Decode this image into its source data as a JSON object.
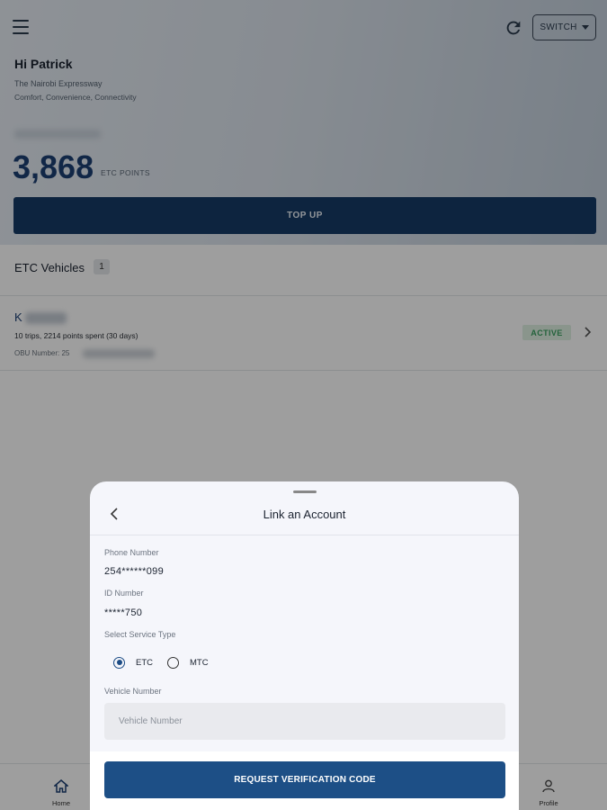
{
  "header": {
    "switch_label": "SWITCH",
    "greeting": "Hi Patrick",
    "tagline": "The Nairobi Expressway",
    "subtagline": "Comfort, Convenience, Connectivity",
    "points": "3,868",
    "points_unit": "ETC POINTS",
    "topup_label": "TOP UP"
  },
  "vehicles": {
    "section_title": "ETC Vehicles",
    "count": "1",
    "items": [
      {
        "name_prefix": "K",
        "stats": "10 trips, 2214 points spent (30 days)",
        "obu_prefix": "OBU Number: 25",
        "status": "ACTIVE"
      }
    ]
  },
  "nav": {
    "home_label": "Home",
    "profile_label": "Profile"
  },
  "sheet": {
    "title": "Link an Account",
    "phone_label": "Phone Number",
    "phone_value": "254******099",
    "id_label": "ID Number",
    "id_value": "*****750",
    "service_label": "Select Service Type",
    "service_options": [
      "ETC",
      "MTC"
    ],
    "service_selected": "ETC",
    "vehicle_label": "Vehicle Number",
    "vehicle_placeholder": "Vehicle Number",
    "request_label": "REQUEST VERIFICATION CODE"
  },
  "colors": {
    "primary": "#163b66",
    "button": "#1d4f86",
    "active_text": "#3aa060",
    "active_bg": "#dff0e3"
  }
}
